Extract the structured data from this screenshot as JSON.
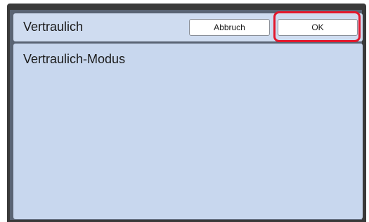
{
  "dialog": {
    "title": "Vertraulich",
    "cancel_label": "Abbruch",
    "ok_label": "OK"
  },
  "content": {
    "mode_label": "Vertraulich-Modus"
  },
  "colors": {
    "highlight": "#e3182d",
    "panel": "#c8d7ee",
    "title_bar": "#cfdcf0"
  }
}
